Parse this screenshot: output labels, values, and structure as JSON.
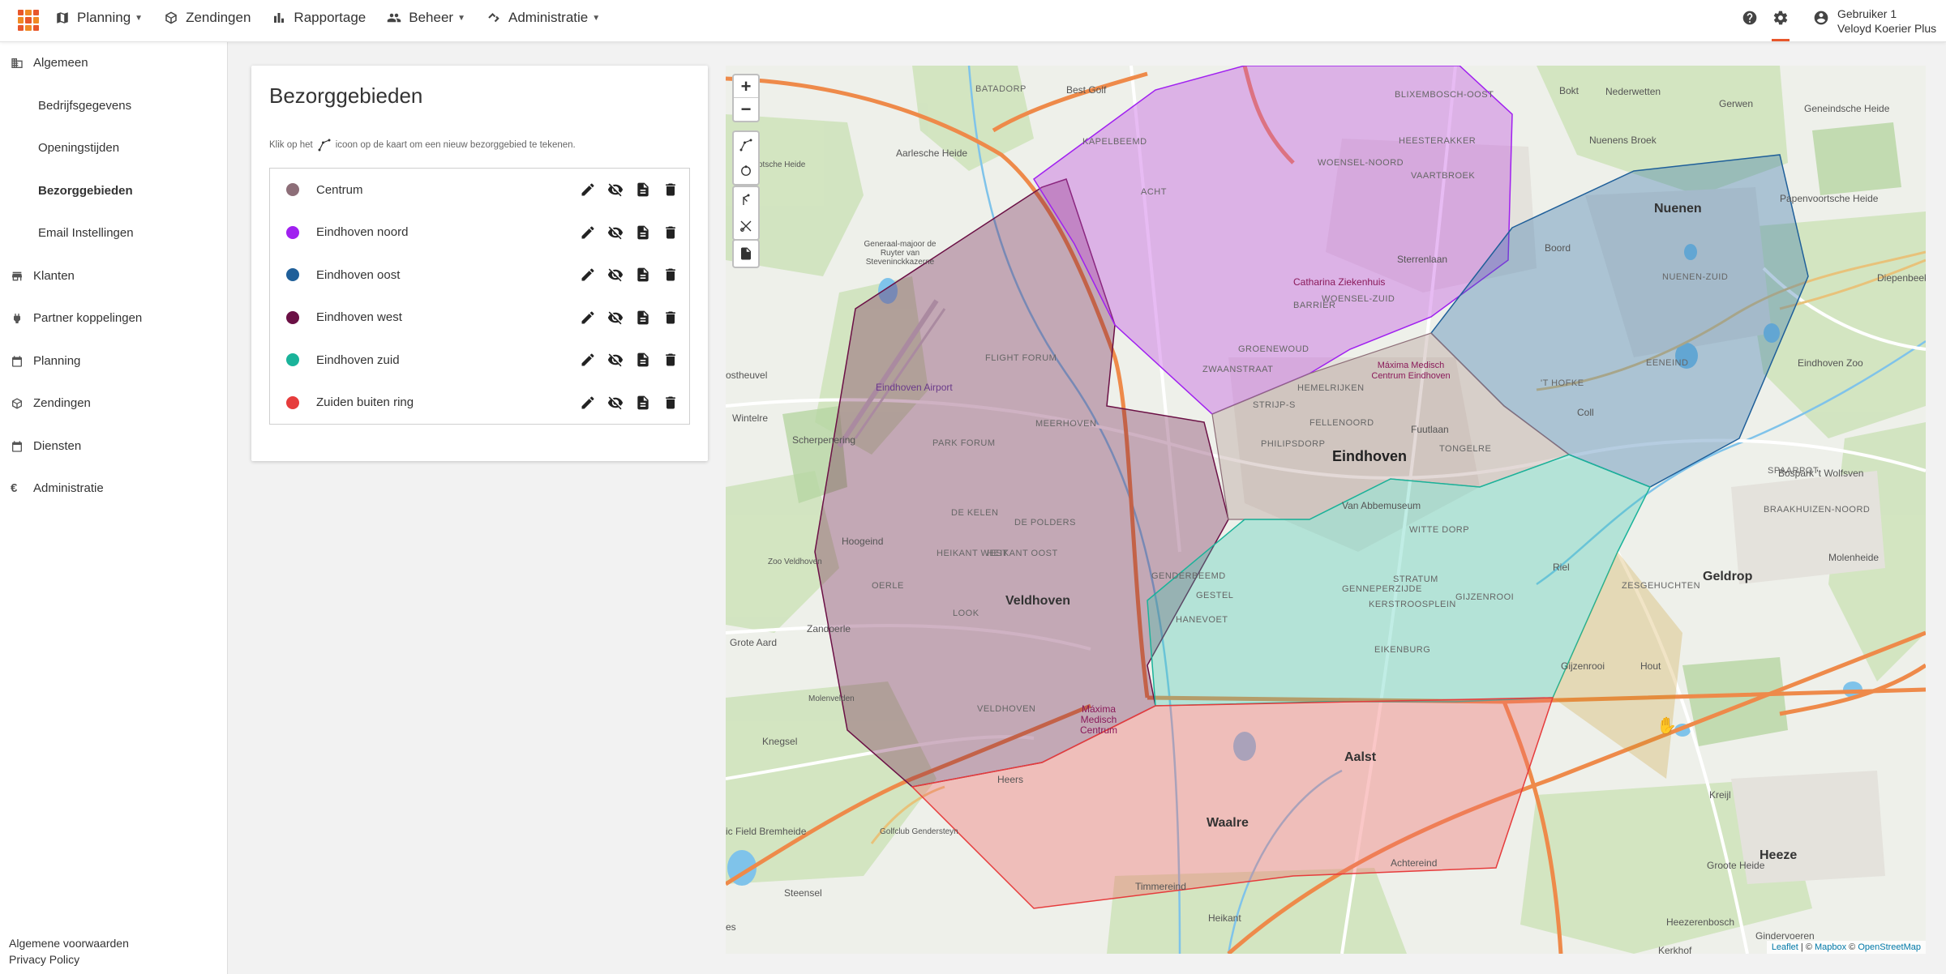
{
  "nav": {
    "items": [
      {
        "label": "Planning",
        "icon": "map-icon",
        "dropdown": true
      },
      {
        "label": "Zendingen",
        "icon": "package-icon",
        "dropdown": false
      },
      {
        "label": "Rapportage",
        "icon": "bar-chart-icon",
        "dropdown": false
      },
      {
        "label": "Beheer",
        "icon": "people-icon",
        "dropdown": true
      },
      {
        "label": "Administratie",
        "icon": "handshake-icon",
        "dropdown": true
      }
    ]
  },
  "user": {
    "name": "Gebruiker 1",
    "company": "Veloyd Koerier Plus"
  },
  "sidebar": {
    "items": [
      {
        "label": "Algemeen",
        "icon": "building-icon"
      },
      {
        "label": "Bedrijfsgegevens",
        "sub": true
      },
      {
        "label": "Openingstijden",
        "sub": true
      },
      {
        "label": "Bezorggebieden",
        "sub": true,
        "active": true
      },
      {
        "label": "Email Instellingen",
        "sub": true
      },
      {
        "label": "Klanten",
        "icon": "store-icon"
      },
      {
        "label": "Partner koppelingen",
        "icon": "plug-icon"
      },
      {
        "label": "Planning",
        "icon": "calendar-icon"
      },
      {
        "label": "Zendingen",
        "icon": "package-icon"
      },
      {
        "label": "Diensten",
        "icon": "calendar-icon"
      },
      {
        "label": "Administratie",
        "icon": "euro-icon"
      }
    ],
    "footer": [
      "Algemene voorwaarden",
      "Privacy Policy"
    ]
  },
  "panel": {
    "title": "Bezorggebieden",
    "hint_before": "Klik op het",
    "hint_after": "icoon op de kaart om een nieuw bezorggebied te tekenen.",
    "areas": [
      {
        "name": "Centrum",
        "color": "#8d6e78"
      },
      {
        "name": "Eindhoven noord",
        "color": "#a020f0"
      },
      {
        "name": "Eindhoven oost",
        "color": "#1f5f99"
      },
      {
        "name": "Eindhoven west",
        "color": "#6b1045"
      },
      {
        "name": "Eindhoven zuid",
        "color": "#1ab39a"
      },
      {
        "name": "Zuiden buiten ring",
        "color": "#e63c3c"
      }
    ]
  },
  "map": {
    "zoom_in": "+",
    "zoom_out": "−",
    "labels": {
      "eindhoven": "Eindhoven",
      "veldhoven": "Veldhoven",
      "nuenen": "Nuenen",
      "geldrop": "Geldrop",
      "waalre": "Waalre",
      "aalst": "Aalst",
      "heeze": "Heeze",
      "airport": "Eindhoven Airport",
      "catharina": "Catharina Ziekenhuis",
      "maxima": "Máxima Medisch Centrum",
      "maxima_e": "Máxima Medisch Centrum Eindhoven",
      "woensel": "WOENSEL-NOORD",
      "woensel_zuid": "WOENSEL-ZUID",
      "strijp": "STRIJP-S",
      "tongelre": "TONGELRE",
      "stratum": "STRATUM",
      "gestel": "GESTEL",
      "vaartbroek": "VAARTBROEK",
      "nederwetten": "Nederwetten",
      "gerwen": "Gerwen",
      "boord": "Boord",
      "coll": "Coll",
      "riel": "Riel",
      "gijzenrooi": "Gijzenrooi",
      "hout": "Hout",
      "kreijl": "Kreijl",
      "heers": "Heers",
      "knegsel": "Knegsel",
      "zandoerle": "Zandoerle",
      "hoogeind": "Hoogeind",
      "steensel": "Steensel",
      "heikant": "Heikant",
      "achtereind": "Achtereind",
      "timmereind": "Timmereind",
      "wintelre": "Wintelre",
      "scherpenering": "Scherpenering",
      "oostheuvel": "ostheuvel",
      "flight_forum": "FLIGHT FORUM",
      "park_forum": "PARK FORUM",
      "meerhoven": "MEERHOVEN",
      "de_kelen": "DE KELEN",
      "de_polders": "DE POLDERS",
      "heikant_west": "HEIKANT WEST",
      "heikant_oost": "HEIKANT OOST",
      "look": "LOOK",
      "oerle": "OERLE",
      "veldhoven_dorp": "VELDHOVEN",
      "kapelbeemd": "KAPELBEEMD",
      "acht": "ACHT",
      "barrier": "BARRIER",
      "groenewoud": "GROENEWOUD",
      "zwaanstraat": "ZWAANSTRAAT",
      "heesterakker": "HEESTERAKKER",
      "hemelrijken": "HEMELRIJKEN",
      "fellenoord": "FELLENOORD",
      "philipsdorp": "PHILIPSDORP",
      "genderbeemd": "GENDERBEEMD",
      "hanevoet": "HANEVOET",
      "genneperzijde": "GENNEPERZIJDE",
      "kerstroosplein": "KERSTROOSPLEIN",
      "eikenburg": "EIKENBURG",
      "witte_dorp": "WITTE DORP",
      "t_hofke": "'T HOFKE",
      "eeneind": "EENEIND",
      "nuenen_zuid": "NUENEN-ZUID",
      "zesgehuchten": "ZESGEHUCHTEN",
      "braakhuizen": "BRAAKHUIZEN-NOORD",
      "spaarpot": "SPAARPOT",
      "gijzenrooi_d": "GIJZENROOI",
      "blixembosch": "BLIXEMBOSCH-OOST",
      "bokt": "Bokt",
      "van_abbe": "Van Abbemuseum",
      "best_golf": "Best Golf",
      "batadorp": "BATADORP",
      "aarlesche": "Aarlesche Heide",
      "heeze_lbl": "Heeze",
      "groote_heide": "Groote Heide",
      "heezerenbosch": "Heezerenbosch",
      "gijzenrooi2": "Gijzenrooi",
      "zoo": "Zoo Veldhoven",
      "molenvelden": "Molenvelden",
      "golfclub": "Golfclub Gendersteyn",
      "kerkhof": "Kerkhof",
      "gindervoeren": "Gindervoeren",
      "molenheide": "Molenheide",
      "dierentuin": "Eindhoven Zoo",
      "diepenbeek": "Diepenbeek",
      "sterrenlaan": "Sterrenlaan",
      "fuutlaan": "Fuutlaan",
      "field": "ic Field Bremheide",
      "grote_aard": "Grote Aard",
      "nuenens_broek": "Nuenens Broek",
      "geneindsche": "Geneindsche Heide",
      "papenvoortsche": "Papenvoortsche Heide",
      "bospark": "Bospark 't Wolfsven",
      "gen_majoor": "Generaal-majoor de Ruyter van Steveninckkazerne",
      "otsche_heide": "otsche Heide",
      "s_lbl": "es"
    },
    "attribution": {
      "leaflet": "Leaflet",
      "mapbox": "Mapbox",
      "osm": "OpenStreetMap"
    }
  }
}
